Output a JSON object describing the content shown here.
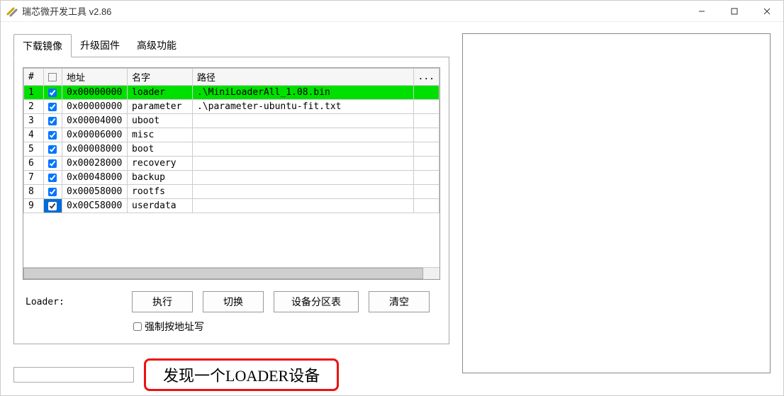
{
  "window": {
    "title": "瑞芯微开发工具 v2.86"
  },
  "tabs": [
    {
      "label": "下载镜像",
      "active": true
    },
    {
      "label": "升级固件",
      "active": false
    },
    {
      "label": "高级功能",
      "active": false
    }
  ],
  "columns": {
    "idx": "#",
    "chk": "",
    "addr": "地址",
    "name": "名字",
    "path": "路径",
    "more": "..."
  },
  "rows": [
    {
      "idx": "1",
      "checked": true,
      "addr": "0x00000000",
      "name": "loader",
      "path": ".\\MiniLoaderAll_1.08.bin",
      "highlight": true
    },
    {
      "idx": "2",
      "checked": true,
      "addr": "0x00000000",
      "name": "parameter",
      "path": ".\\parameter-ubuntu-fit.txt"
    },
    {
      "idx": "3",
      "checked": true,
      "addr": "0x00004000",
      "name": "uboot",
      "path": ""
    },
    {
      "idx": "4",
      "checked": true,
      "addr": "0x00006000",
      "name": "misc",
      "path": ""
    },
    {
      "idx": "5",
      "checked": true,
      "addr": "0x00008000",
      "name": "boot",
      "path": ""
    },
    {
      "idx": "6",
      "checked": true,
      "addr": "0x00028000",
      "name": "recovery",
      "path": ""
    },
    {
      "idx": "7",
      "checked": true,
      "addr": "0x00048000",
      "name": "backup",
      "path": ""
    },
    {
      "idx": "8",
      "checked": true,
      "addr": "0x00058000",
      "name": "rootfs",
      "path": ""
    },
    {
      "idx": "9",
      "checked": true,
      "addr": "0x00C58000",
      "name": "userdata",
      "path": "",
      "selected": true
    }
  ],
  "controls": {
    "loader_label": "Loader:",
    "execute": "执行",
    "switch": "切换",
    "partition_table": "设备分区表",
    "clear": "清空",
    "force_write": "强制按地址写",
    "force_write_checked": false
  },
  "status": {
    "message": "发现一个LOADER设备"
  }
}
